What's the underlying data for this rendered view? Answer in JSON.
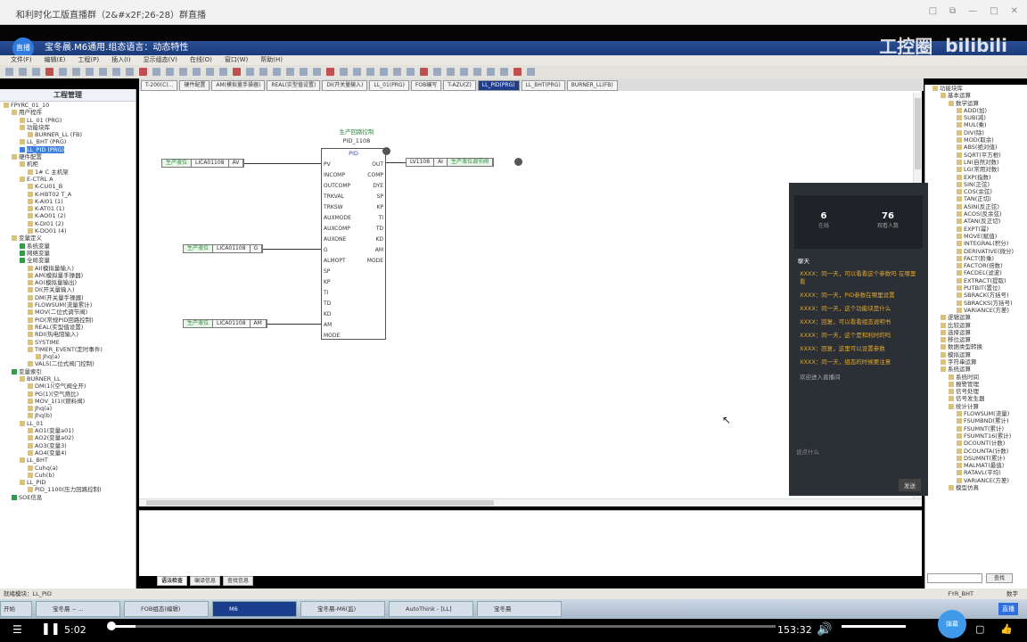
{
  "browser": {
    "title": "和利时化工版直播群（2&#x2F;26-28）群直播",
    "controls": [
      "□",
      "⧉",
      "—",
      "□",
      "✕"
    ]
  },
  "app": {
    "title": "宝冬晨.M6通用.组态语言：动态特性",
    "live_badge": "直播",
    "watermark": [
      "工控圈",
      "bilibili"
    ]
  },
  "menu": [
    "文件(F)",
    "编辑(E)",
    "工程(P)",
    "插入(I)",
    "显示组态(V)",
    "在线(O)",
    "窗口(W)",
    "帮助(H)"
  ],
  "tabs": [
    {
      "label": "T-200(C)..."
    },
    {
      "label": "硬件配置"
    },
    {
      "label": "AM(模拟量手操器)"
    },
    {
      "label": "REAL(实型值设置)"
    },
    {
      "label": "DI(开关量输入)"
    },
    {
      "label": "LL_01(PRG)"
    },
    {
      "label": "FOB编写"
    },
    {
      "label": "T-AZU(Z)"
    },
    {
      "label": "LL_PID(PRG)",
      "active": true
    },
    {
      "label": "LL_BHT(PRG)"
    },
    {
      "label": "BURNER_LL(FB)"
    }
  ],
  "left_panel": {
    "title": "工程管理",
    "items": [
      {
        "t": "FPYRC_01_10",
        "l": 0
      },
      {
        "t": "用户程序",
        "l": 1
      },
      {
        "t": "LL_01 (PRG)",
        "l": 2
      },
      {
        "t": "功能块库",
        "l": 2
      },
      {
        "t": "BURNER_LL (FB)",
        "l": 3
      },
      {
        "t": "LL_BHT (PRG)",
        "l": 2
      },
      {
        "t": "LL_PID (PRG)",
        "l": 2,
        "sel": true
      },
      {
        "t": "硬件配置",
        "l": 1
      },
      {
        "t": "机柜",
        "l": 2
      },
      {
        "t": "1# C 主机架",
        "l": 3
      },
      {
        "t": "E-CTRL A",
        "l": 2
      },
      {
        "t": "K-CU01_B",
        "l": 3
      },
      {
        "t": "K-HBT02 T_A",
        "l": 3
      },
      {
        "t": "K-AI01 (1)",
        "l": 3
      },
      {
        "t": "K-AT01 (1)",
        "l": 3
      },
      {
        "t": "K-AO01 (2)",
        "l": 3
      },
      {
        "t": "K-DI01 (2)",
        "l": 3
      },
      {
        "t": "K-DO01 (4)",
        "l": 3
      },
      {
        "t": "变量定义",
        "l": 1
      },
      {
        "t": "系统变量",
        "l": 2,
        "g": true
      },
      {
        "t": "网络变量",
        "l": 2,
        "g": true
      },
      {
        "t": "全局变量",
        "l": 2,
        "g": true
      },
      {
        "t": "AI(模拟量输入)",
        "l": 3
      },
      {
        "t": "AM(模拟量手操器)",
        "l": 3
      },
      {
        "t": "AO(模拟量输出)",
        "l": 3
      },
      {
        "t": "DI(开关量输入)",
        "l": 3
      },
      {
        "t": "DM(开关量手操器)",
        "l": 3
      },
      {
        "t": "FLOWSUM(流量累计)",
        "l": 3
      },
      {
        "t": "MOV(二位式调节阀)",
        "l": 3
      },
      {
        "t": "PID(常规PID回路控制)",
        "l": 3
      },
      {
        "t": "REAL(实型值设置)",
        "l": 3
      },
      {
        "t": "RDI(热电阻输入)",
        "l": 3
      },
      {
        "t": "SYSTIME",
        "l": 3
      },
      {
        "t": "TIMER_EVENT(定时事件)",
        "l": 3
      },
      {
        "t": "Jhq(a)",
        "l": 4
      },
      {
        "t": "VALS(二位式阀门控制)",
        "l": 3
      },
      {
        "t": "变量索引",
        "l": 1,
        "g": true
      },
      {
        "t": "BURNER_LL",
        "l": 2
      },
      {
        "t": "DM(1)(空气阀全开)",
        "l": 3
      },
      {
        "t": "PG(1)(空气燃比)",
        "l": 3
      },
      {
        "t": "MOV_1(1)(燃料阀)",
        "l": 3
      },
      {
        "t": "Jhq(a)",
        "l": 3
      },
      {
        "t": "Jhq(b)",
        "l": 3
      },
      {
        "t": "LL_01",
        "l": 2
      },
      {
        "t": "AO1(变量a01)",
        "l": 3
      },
      {
        "t": "AO2(变量a02)",
        "l": 3
      },
      {
        "t": "AO3(变量3)",
        "l": 3
      },
      {
        "t": "AO4(变量4)",
        "l": 3
      },
      {
        "t": "LL_BHT",
        "l": 2
      },
      {
        "t": "Cuhq(a)",
        "l": 3
      },
      {
        "t": "Cuh(b)",
        "l": 3
      },
      {
        "t": "LL_PID",
        "l": 2
      },
      {
        "t": "PID_1100(压力回路控制)",
        "l": 3
      },
      {
        "t": "SOE信息",
        "l": 1,
        "g": true
      }
    ]
  },
  "diagram": {
    "block_label": "生产回路控制",
    "block_name": "PID_1108",
    "block_type": "PID",
    "inputs": [
      "PV",
      "INCOMP",
      "OUTCOMP",
      "TRKVAL",
      "TRKSW",
      "AUXMODE",
      "AUXCOMP",
      "AUXONE",
      "G",
      "ALMOPT",
      "SP",
      "KP",
      "TI",
      "TD",
      "KD",
      "AM",
      "MODE"
    ],
    "outputs": [
      "OUT",
      "COMP",
      "DYE",
      "SP",
      "KP",
      "TI",
      "TD",
      "KD",
      "AM",
      "MODE"
    ],
    "in_blocks": [
      {
        "desc": "生产液位",
        "tag": "LICA01108",
        "pin": "AV"
      },
      {
        "desc": "生产液位",
        "tag": "LICA01108",
        "pin": "G"
      },
      {
        "desc": "生产液位",
        "tag": "LICA01108",
        "pin": "AM"
      }
    ],
    "out_block": {
      "tag": "LV1108",
      "pin": "AI",
      "desc": "生产液位调节阀"
    }
  },
  "bottom_tabs": [
    {
      "label": "语法检查",
      "active": true
    },
    {
      "label": "编译信息"
    },
    {
      "label": "查找信息"
    }
  ],
  "right_panel": {
    "items": [
      {
        "t": "功能块库",
        "l": 0
      },
      {
        "t": "基本运算",
        "l": 1
      },
      {
        "t": "数学运算",
        "l": 2
      },
      {
        "t": "ADD(加)",
        "l": 3
      },
      {
        "t": "SUB(减)",
        "l": 3
      },
      {
        "t": "MUL(乘)",
        "l": 3
      },
      {
        "t": "DIV(除)",
        "l": 3
      },
      {
        "t": "MOD(取余)",
        "l": 3
      },
      {
        "t": "ABS(绝对值)",
        "l": 3
      },
      {
        "t": "SQRT(平方根)",
        "l": 3
      },
      {
        "t": "LN(自然对数)",
        "l": 3
      },
      {
        "t": "LG(常用对数)",
        "l": 3
      },
      {
        "t": "EXP(指数)",
        "l": 3
      },
      {
        "t": "SIN(正弦)",
        "l": 3
      },
      {
        "t": "COS(余弦)",
        "l": 3
      },
      {
        "t": "TAN(正切)",
        "l": 3
      },
      {
        "t": "ASIN(反正弦)",
        "l": 3
      },
      {
        "t": "ACOS(反余弦)",
        "l": 3
      },
      {
        "t": "ATAN(反正切)",
        "l": 3
      },
      {
        "t": "EXPT(幂)",
        "l": 3
      },
      {
        "t": "MOVE(赋值)",
        "l": 3
      },
      {
        "t": "INTEGRAL(积分)",
        "l": 3
      },
      {
        "t": "DERIVATIVE(微分)",
        "l": 3
      },
      {
        "t": "FACT(阶乘)",
        "l": 3
      },
      {
        "t": "FACTOR(倍数)",
        "l": 3
      },
      {
        "t": "FACDEL(滤波)",
        "l": 3
      },
      {
        "t": "EXTRACT(提取)",
        "l": 3
      },
      {
        "t": "PUTBIT(置位)",
        "l": 3
      },
      {
        "t": "SBRACK(方括号)",
        "l": 3
      },
      {
        "t": "SBRACKS(方括号)",
        "l": 3
      },
      {
        "t": "VARIANCE(方差)",
        "l": 3
      },
      {
        "t": "逻辑运算",
        "l": 1
      },
      {
        "t": "比较运算",
        "l": 1
      },
      {
        "t": "选择运算",
        "l": 1
      },
      {
        "t": "移位运算",
        "l": 1
      },
      {
        "t": "数据类型转换",
        "l": 1
      },
      {
        "t": "模拟运算",
        "l": 1
      },
      {
        "t": "字符串运算",
        "l": 1
      },
      {
        "t": "系统运算",
        "l": 1
      },
      {
        "t": "系统时间",
        "l": 2
      },
      {
        "t": "报警管理",
        "l": 2
      },
      {
        "t": "信号处理",
        "l": 2
      },
      {
        "t": "信号发生器",
        "l": 2
      },
      {
        "t": "统计计算",
        "l": 2
      },
      {
        "t": "FLOWSUM(流量)",
        "l": 3
      },
      {
        "t": "FSUMBND(累计)",
        "l": 3
      },
      {
        "t": "FSUMNT(累计)",
        "l": 3
      },
      {
        "t": "FSUMNT16(累计)",
        "l": 3
      },
      {
        "t": "DCOUNT(计数)",
        "l": 3
      },
      {
        "t": "DCOUNTA(计数)",
        "l": 3
      },
      {
        "t": "DSUMNT(累计)",
        "l": 3
      },
      {
        "t": "MALMAT(最值)",
        "l": 3
      },
      {
        "t": "RATAVL(平均)",
        "l": 3
      },
      {
        "t": "VARIANCE(方差)",
        "l": 3
      },
      {
        "t": "模型仿真",
        "l": 2
      }
    ],
    "search_button": "查找"
  },
  "chat": {
    "stats": [
      {
        "value": "6",
        "label": "在线"
      },
      {
        "value": "76",
        "label": "观看人数"
      }
    ],
    "section": "聊天",
    "messages": [
      "XXXX：同一天，可以看看这个参数吗 在哪里看",
      "XXXX：同一天，PID参数在哪里设置",
      "XXXX：同一天，这个功能块是什么",
      "XXXX：回复，可以看看组态说明书",
      "XXXX：同一天，这个是和利时的吗",
      "XXXX：回复，这里可以设置参数",
      "XXXX：同一天，组态的时候要注意"
    ],
    "system_note": "欢迎进入直播间",
    "input_placeholder": "说点什么",
    "send": "发送"
  },
  "status_bar": {
    "text": "就绪模块：LL_PID",
    "right": [
      "FYR_BHT",
      "数字"
    ]
  },
  "taskbar": {
    "items": [
      {
        "label": "开始"
      },
      {
        "label": "宝冬晨 -- ..."
      },
      {
        "label": "FOB组态(编辑)"
      },
      {
        "label": "M6",
        "active": true
      },
      {
        "label": "宝冬晨-M6(监)"
      },
      {
        "label": "AutoThink - [LL]"
      },
      {
        "label": "宝冬晨"
      }
    ],
    "tray": "直播"
  },
  "player": {
    "current": "5:02",
    "total": "153:32",
    "progress_percent": 3.3,
    "volume_percent": 100,
    "danmu": "弹幕"
  }
}
